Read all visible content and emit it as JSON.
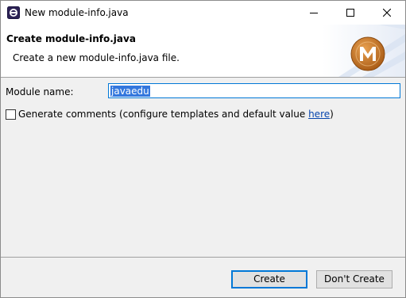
{
  "window": {
    "title": "New module-info.java",
    "controls": {
      "minimize_icon": "minimize-icon",
      "maximize_icon": "maximize-icon",
      "close_icon": "close-icon"
    }
  },
  "banner": {
    "title": "Create module-info.java",
    "description": "Create a new module-info.java file.",
    "logo_letter": "M",
    "logo_color": "#c8741c"
  },
  "form": {
    "module_name_label": "Module name:",
    "module_name_value": "javaedu",
    "generate_comments_checked": false,
    "generate_comments_label": "Generate comments (configure templates and default value ",
    "generate_comments_link": "here",
    "generate_comments_suffix": ")"
  },
  "buttons": {
    "create": "Create",
    "dont_create": "Don't Create"
  },
  "colors": {
    "accent": "#0078d7",
    "selection": "#3377dd",
    "link": "#0645ad"
  }
}
